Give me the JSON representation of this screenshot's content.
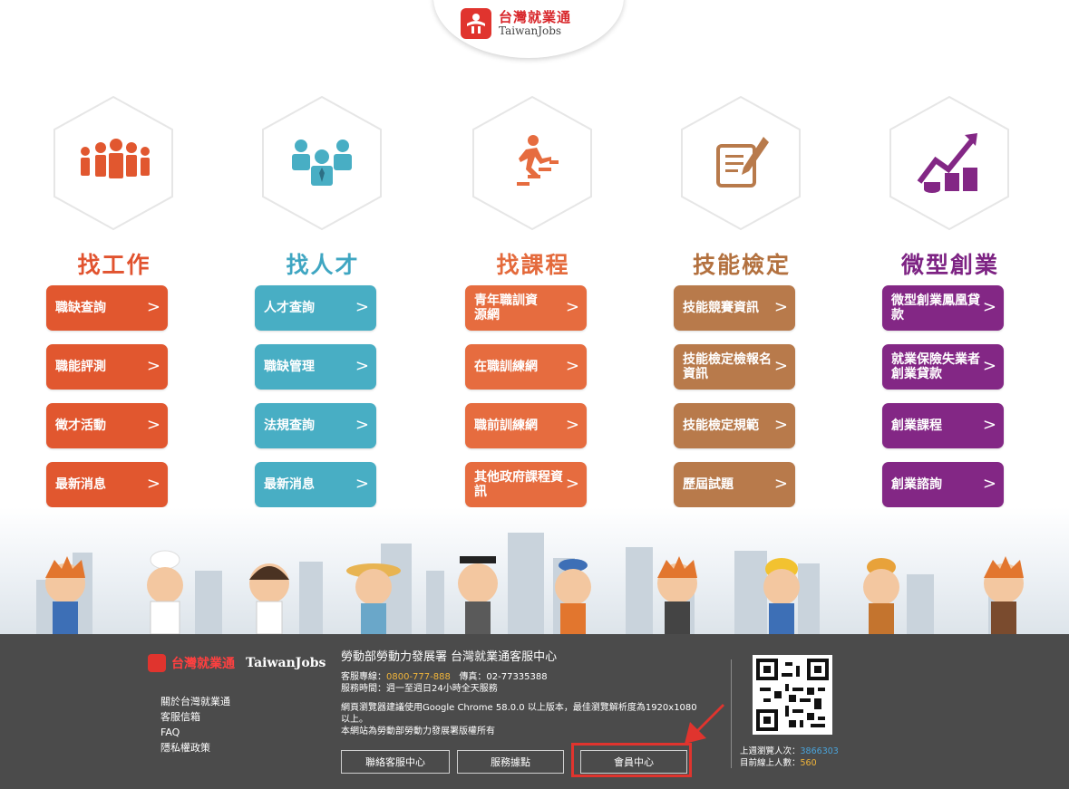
{
  "brand": {
    "name_cn": "台灣就業通",
    "name_en": "TaiwanJobs"
  },
  "columns": [
    {
      "title": "找工作",
      "icon": "people-group-icon",
      "color": "#e1572f",
      "buttons": [
        "職缺查詢",
        "職能評測",
        "徵才活動",
        "最新消息"
      ]
    },
    {
      "title": "找人才",
      "icon": "business-team-icon",
      "color": "#48aec4",
      "buttons": [
        "人才查詢",
        "職缺管理",
        "法規查詢",
        "最新消息"
      ]
    },
    {
      "title": "找課程",
      "icon": "stairs-runner-icon",
      "color": "#e66c3f",
      "buttons": [
        "青年職訓資源網",
        "在職訓練網",
        "職前訓練網",
        "其他政府課程資訊"
      ]
    },
    {
      "title": "技能檢定",
      "icon": "document-pen-icon",
      "color": "#b87a4b",
      "buttons": [
        "技能競賽資訊",
        "技能檢定檢報名資訊",
        "技能檢定規範",
        "歷屆試題"
      ]
    },
    {
      "title": "微型創業",
      "icon": "growth-coins-icon",
      "color": "#832785",
      "buttons": [
        "微型創業鳳凰貸款",
        "就業保險失業者創業貸款",
        "創業課程",
        "創業諮詢"
      ]
    }
  ],
  "footer": {
    "links": [
      "關於台灣就業通",
      "客服信箱",
      "FAQ",
      "隱私權政策"
    ],
    "org": "勞動部勞動力發展署 台灣就業通客服中心",
    "hotline_label": "客服專線：",
    "hotline": "0800-777-888",
    "fax": "傳真：02-77335388",
    "hours": "服務時間：週一至週日24小時全天服務",
    "browser_note": "網頁瀏覽器建議使用Google Chrome 58.0.0 以上版本，最佳瀏覽解析度為1920x1080以上。",
    "copyright": "本網站為勞動部勞動力發展署版權所有",
    "buttons": [
      "聯絡客服中心",
      "服務據點",
      "會員中心"
    ],
    "stats": {
      "last_week_label": "上週瀏覽人次：",
      "last_week": "3866303",
      "online_label": "目前線上人數：",
      "online": "560"
    }
  }
}
